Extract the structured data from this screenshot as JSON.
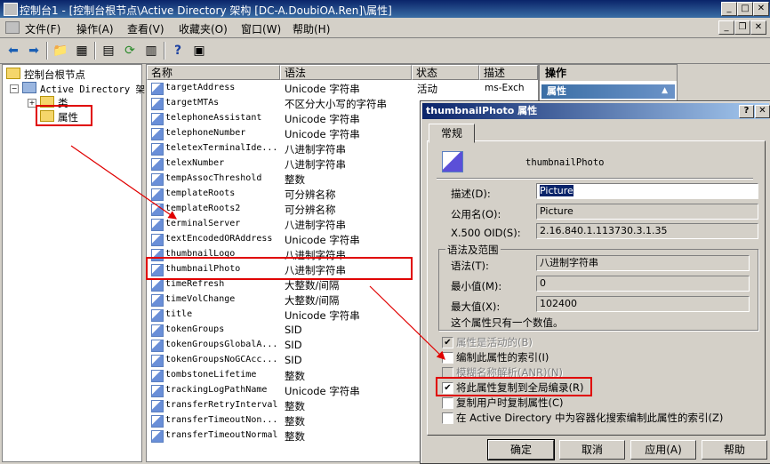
{
  "window": {
    "title": "控制台1 - [控制台根节点\\Active Directory 架构 [DC-A.DoubiOA.Ren]\\属性]"
  },
  "menu": {
    "items": [
      "文件(F)",
      "操作(A)",
      "查看(V)",
      "收藏夹(O)",
      "窗口(W)",
      "帮助(H)"
    ]
  },
  "tree": {
    "root": "控制台根节点",
    "ad": "Active Directory 架",
    "classes": "类",
    "attributes": "属性"
  },
  "list": {
    "headers": {
      "name": "名称",
      "syntax": "语法",
      "status": "状态",
      "description": "描述"
    },
    "rows": [
      {
        "name": "targetAddress",
        "syntax": "Unicode 字符串",
        "status": "活动",
        "description": "ms-Exch"
      },
      {
        "name": "targetMTAs",
        "syntax": "不区分大小写的字符串",
        "status": "",
        "description": ""
      },
      {
        "name": "telephoneAssistant",
        "syntax": "Unicode 字符串",
        "status": "",
        "description": ""
      },
      {
        "name": "telephoneNumber",
        "syntax": "Unicode 字符串",
        "status": "",
        "description": ""
      },
      {
        "name": "teletexTerminalIde...",
        "syntax": "八进制字符串",
        "status": "",
        "description": ""
      },
      {
        "name": "telexNumber",
        "syntax": "八进制字符串",
        "status": "",
        "description": ""
      },
      {
        "name": "tempAssocThreshold",
        "syntax": "整数",
        "status": "",
        "description": ""
      },
      {
        "name": "templateRoots",
        "syntax": "可分辨名称",
        "status": "",
        "description": ""
      },
      {
        "name": "templateRoots2",
        "syntax": "可分辨名称",
        "status": "",
        "description": ""
      },
      {
        "name": "terminalServer",
        "syntax": "八进制字符串",
        "status": "",
        "description": ""
      },
      {
        "name": "textEncodedORAddress",
        "syntax": "Unicode 字符串",
        "status": "",
        "description": ""
      },
      {
        "name": "thumbnailLogo",
        "syntax": "八进制字符串",
        "status": "",
        "description": ""
      },
      {
        "name": "thumbnailPhoto",
        "syntax": "八进制字符串",
        "status": "",
        "description": ""
      },
      {
        "name": "timeRefresh",
        "syntax": "大整数/间隔",
        "status": "",
        "description": ""
      },
      {
        "name": "timeVolChange",
        "syntax": "大整数/间隔",
        "status": "",
        "description": ""
      },
      {
        "name": "title",
        "syntax": "Unicode 字符串",
        "status": "",
        "description": ""
      },
      {
        "name": "tokenGroups",
        "syntax": "SID",
        "status": "",
        "description": ""
      },
      {
        "name": "tokenGroupsGlobalA...",
        "syntax": "SID",
        "status": "",
        "description": ""
      },
      {
        "name": "tokenGroupsNoGCAcc...",
        "syntax": "SID",
        "status": "",
        "description": ""
      },
      {
        "name": "tombstoneLifetime",
        "syntax": "整数",
        "status": "",
        "description": ""
      },
      {
        "name": "trackingLogPathName",
        "syntax": "Unicode 字符串",
        "status": "",
        "description": ""
      },
      {
        "name": "transferRetryInterval",
        "syntax": "整数",
        "status": "",
        "description": ""
      },
      {
        "name": "transferTimeoutNon...",
        "syntax": "整数",
        "status": "",
        "description": ""
      },
      {
        "name": "transferTimeoutNormal",
        "syntax": "整数",
        "status": "",
        "description": ""
      }
    ]
  },
  "actions": {
    "header": "操作",
    "section": "属性"
  },
  "dialog": {
    "title": "thumbnailPhoto 属性",
    "tab": "常规",
    "attr_name": "thumbnailPhoto",
    "description_label": "描述(D):",
    "description_value": "Picture",
    "common_name_label": "公用名(O):",
    "common_name_value": "Picture",
    "oid_label": "X.500 OID(S):",
    "oid_value": "2.16.840.1.113730.3.1.35",
    "syntax_group": "语法及范围",
    "syntax_label": "语法(T):",
    "syntax_value": "八进制字符串",
    "min_label": "最小值(M):",
    "min_value": "0",
    "max_label": "最大值(X):",
    "max_value": "102400",
    "single_value_note": "这个属性只有一个数值。",
    "checkboxes": [
      {
        "label": "属性是活动的(B)",
        "checked": true,
        "disabled": true
      },
      {
        "label": "编制此属性的索引(I)",
        "checked": false,
        "disabled": false
      },
      {
        "label": "模糊名称解析(ANR)(N)",
        "checked": false,
        "disabled": true
      },
      {
        "label": "将此属性复制到全局编录(R)",
        "checked": true,
        "disabled": false
      },
      {
        "label": "复制用户时复制属性(C)",
        "checked": false,
        "disabled": false
      },
      {
        "label": "在 Active Directory 中为容器化搜索编制此属性的索引(Z)",
        "checked": false,
        "disabled": false
      }
    ],
    "buttons": {
      "ok": "确定",
      "cancel": "取消",
      "apply": "应用(A)",
      "help": "帮助"
    }
  },
  "colors": {
    "highlight": "#e00000",
    "titlebar": "#0a246a",
    "selection": "#0a246a"
  }
}
